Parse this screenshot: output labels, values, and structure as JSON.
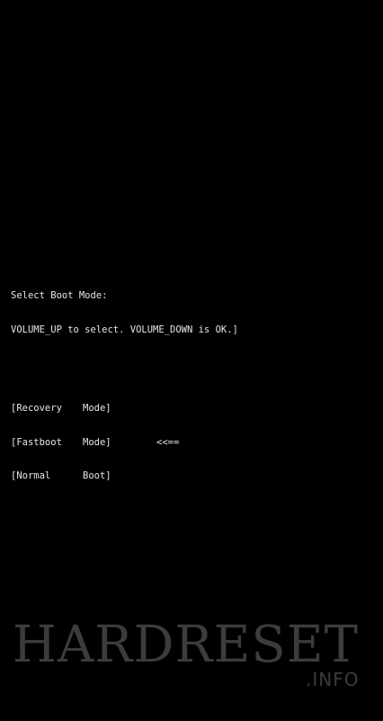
{
  "boot_menu": {
    "prompt": "Select Boot Mode:",
    "instructions": "VOLUME_UP to select. VOLUME_DOWN is OK.]",
    "options": [
      {
        "name": "[Recovery",
        "kind": "Mode]",
        "cursor": ""
      },
      {
        "name": "[Fastboot",
        "kind": "Mode]",
        "cursor": "<<=="
      },
      {
        "name": "[Normal",
        "kind": "Boot]",
        "cursor": ""
      }
    ],
    "selected_index": 1
  },
  "watermark": {
    "main": "HARDRESET",
    "sub": ".INFO"
  },
  "colors": {
    "background": "#000000",
    "text": "#e6e6e6",
    "watermark": "#3c3c3c"
  }
}
